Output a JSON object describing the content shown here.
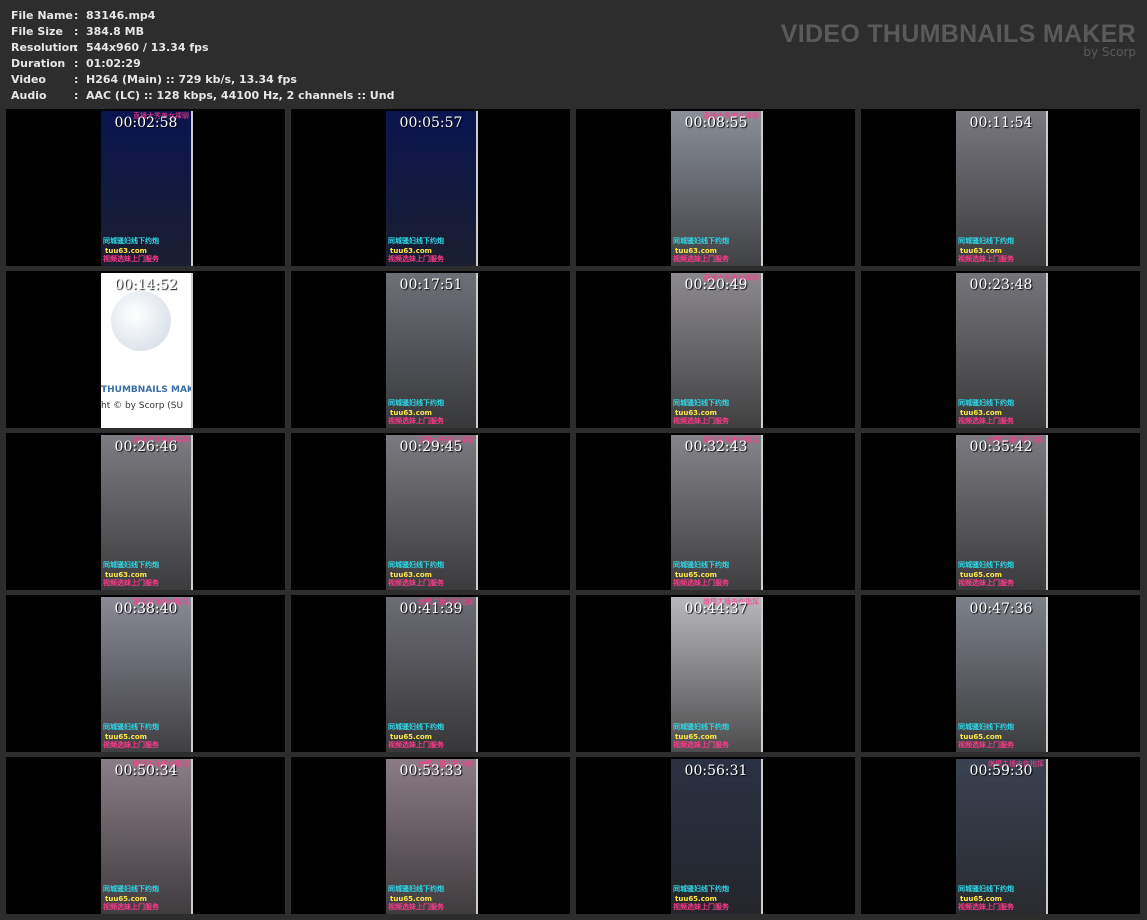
{
  "info": [
    {
      "key": "File Name",
      "value": "83146.mp4"
    },
    {
      "key": "File Size",
      "value": "384.8 MB"
    },
    {
      "key": "Resolution",
      "value": "544x960 / 13.34 fps"
    },
    {
      "key": "Duration",
      "value": "01:02:29"
    },
    {
      "key": "Video",
      "value": "H264 (Main) :: 729 kb/s, 13.34 fps"
    },
    {
      "key": "Audio",
      "value": "AAC (LC) :: 128 kbps, 44100 Hz, 2 channels :: Und"
    }
  ],
  "brand": {
    "title": "VIDEO THUMBNAILS MAKER",
    "by": "by Scorp"
  },
  "captions": {
    "line1": "同城骚妇线下约炮",
    "line3": "视频选妹上门服务"
  },
  "logo_frame": {
    "line1": "THUMBNAILS MAKER",
    "line2": "ht © by Scorp (SU"
  },
  "thumbs": [
    {
      "time": "00:02:58",
      "top": "直播大秀美女裸聊",
      "site": "tuu63.com",
      "bg": "#0a1550"
    },
    {
      "time": "00:05:57",
      "top": "",
      "site": "tuu63.com",
      "bg": "#0a1550"
    },
    {
      "time": "00:08:55",
      "top": "直播大秀美女裸聊",
      "site": "tuu63.com",
      "bg": "#8a8f98"
    },
    {
      "time": "00:11:54",
      "top": "",
      "site": "tuu63.com",
      "bg": "#7a7880"
    },
    {
      "time": "00:14:52",
      "logo": true
    },
    {
      "time": "00:17:51",
      "top": "",
      "site": "tuu63.com",
      "bg": "#6e7078"
    },
    {
      "time": "00:20:49",
      "top": "直播大秀美女裸聊",
      "site": "tuu63.com",
      "bg": "#8c8a8e"
    },
    {
      "time": "00:23:48",
      "top": "",
      "site": "tuu63.com",
      "bg": "#75747a"
    },
    {
      "time": "00:26:46",
      "top": "直播大秀美女裸聊",
      "site": "tuu63.com",
      "bg": "#7d7c82"
    },
    {
      "time": "00:29:45",
      "top": "直播大秀美女裸聊",
      "site": "tuu63.com",
      "bg": "#7a7a80"
    },
    {
      "time": "00:32:43",
      "top": "嫩模主播由你指挥",
      "site": "tuu65.com",
      "bg": "#85848a"
    },
    {
      "time": "00:35:42",
      "top": "嫩模主播由你指挥",
      "site": "tuu65.com",
      "bg": "#7a7a80"
    },
    {
      "time": "00:38:40",
      "top": "嫩模主播由你指挥",
      "site": "tuu65.com",
      "bg": "#8a8a96"
    },
    {
      "time": "00:41:39",
      "top": "嫩模主播由你指挥",
      "site": "tuu65.com",
      "bg": "#6c6c74"
    },
    {
      "time": "00:44:37",
      "top": "嫩模主播由你指挥",
      "site": "tuu65.com",
      "bg": "#b8b8bc"
    },
    {
      "time": "00:47:36",
      "top": "",
      "site": "tuu65.com",
      "bg": "#7c8088"
    },
    {
      "time": "00:50:34",
      "top": "嫩模主播由你指挥",
      "site": "tuu65.com",
      "bg": "#8a7e86"
    },
    {
      "time": "00:53:33",
      "top": "嫩模主播由你指挥",
      "site": "tuu65.com",
      "bg": "#8a7c84"
    },
    {
      "time": "00:56:31",
      "top": "",
      "site": "tuu65.com",
      "bg": "#2a3142"
    },
    {
      "time": "00:59:30",
      "top": "嫩模主播由你指挥",
      "site": "tuu65.com",
      "bg": "#3a4150"
    }
  ]
}
